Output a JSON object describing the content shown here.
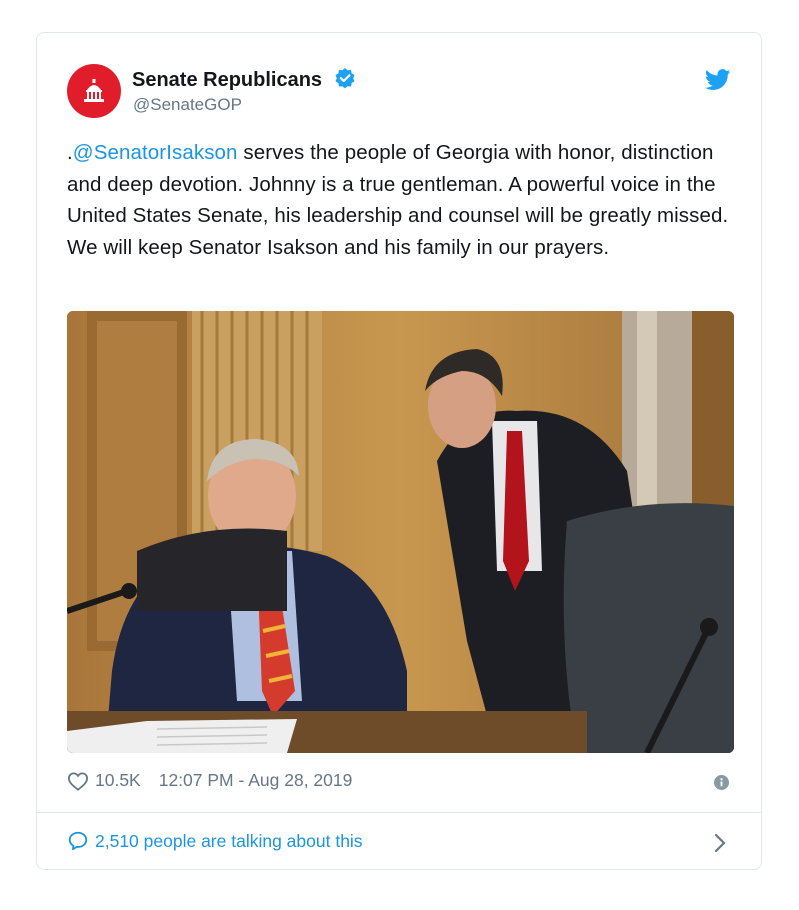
{
  "author": {
    "name": "Senate Republicans",
    "handle": "@SenateGOP",
    "avatar_icon": "capitol-dome-icon",
    "avatar_color": "#e11d2c",
    "verified": true
  },
  "tweet": {
    "prefix": ".",
    "mention": "@SenatorIsakson",
    "body": " serves the people of Georgia with honor, distinction and deep devotion. Johnny is a true gentleman.   A powerful voice in the United States Senate, his leadership and counsel will be greatly missed. We will keep Senator Isakson and his family in our prayers."
  },
  "footer": {
    "like_count": "10.5K",
    "timestamp": "12:07 PM - Aug 28, 2019",
    "talking": "2,510 people are talking about this"
  },
  "colors": {
    "accent": "#1b95e0",
    "muted": "#657786",
    "border": "#e1e8ed"
  }
}
